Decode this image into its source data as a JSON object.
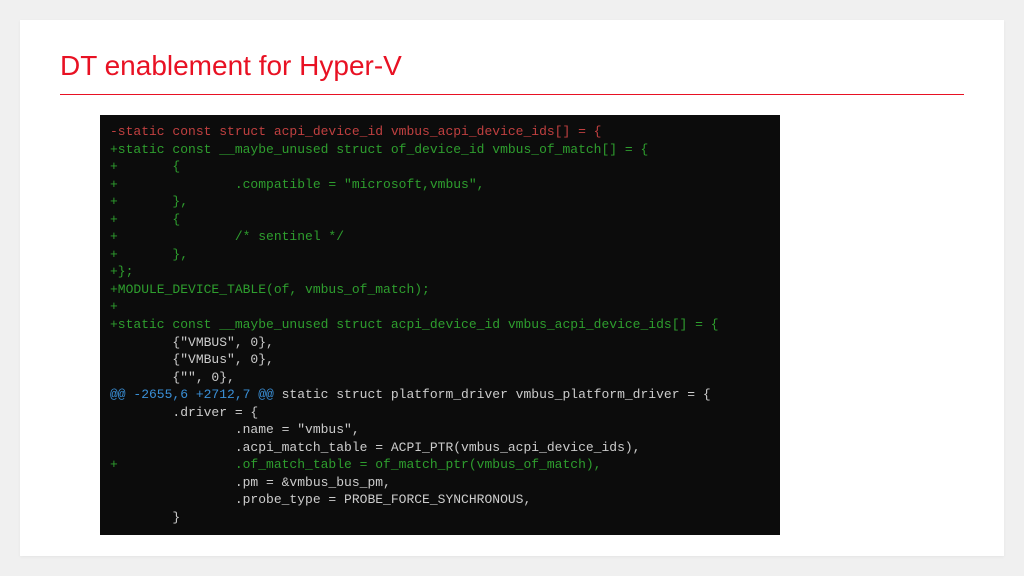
{
  "title": "DT enablement for Hyper-V",
  "diff": [
    {
      "type": "del",
      "text": "-static const struct acpi_device_id vmbus_acpi_device_ids[] = {"
    },
    {
      "type": "add",
      "text": "+static const __maybe_unused struct of_device_id vmbus_of_match[] = {"
    },
    {
      "type": "add",
      "text": "+       {"
    },
    {
      "type": "add",
      "text": "+               .compatible = \"microsoft,vmbus\","
    },
    {
      "type": "add",
      "text": "+       },"
    },
    {
      "type": "add",
      "text": "+       {"
    },
    {
      "type": "add",
      "text": "+               /* sentinel */"
    },
    {
      "type": "add",
      "text": "+       },"
    },
    {
      "type": "add",
      "text": "+};"
    },
    {
      "type": "add",
      "text": "+MODULE_DEVICE_TABLE(of, vmbus_of_match);"
    },
    {
      "type": "add",
      "text": "+"
    },
    {
      "type": "add",
      "text": "+static const __maybe_unused struct acpi_device_id vmbus_acpi_device_ids[] = {"
    },
    {
      "type": "ctx",
      "text": "        {\"VMBUS\", 0},"
    },
    {
      "type": "ctx",
      "text": "        {\"VMBus\", 0},"
    },
    {
      "type": "ctx",
      "text": "        {\"\", 0},"
    },
    {
      "type": "hunk",
      "prefix": "@@ -2655,6 +2712,7 @@",
      "suffix": " static struct platform_driver vmbus_platform_driver = {"
    },
    {
      "type": "ctx",
      "text": "        .driver = {"
    },
    {
      "type": "ctx",
      "text": "                .name = \"vmbus\","
    },
    {
      "type": "ctx",
      "text": "                .acpi_match_table = ACPI_PTR(vmbus_acpi_device_ids),"
    },
    {
      "type": "add",
      "text": "+               .of_match_table = of_match_ptr(vmbus_of_match),"
    },
    {
      "type": "ctx",
      "text": "                .pm = &vmbus_bus_pm,"
    },
    {
      "type": "ctx",
      "text": "                .probe_type = PROBE_FORCE_SYNCHRONOUS,"
    },
    {
      "type": "ctx",
      "text": "        }"
    }
  ]
}
